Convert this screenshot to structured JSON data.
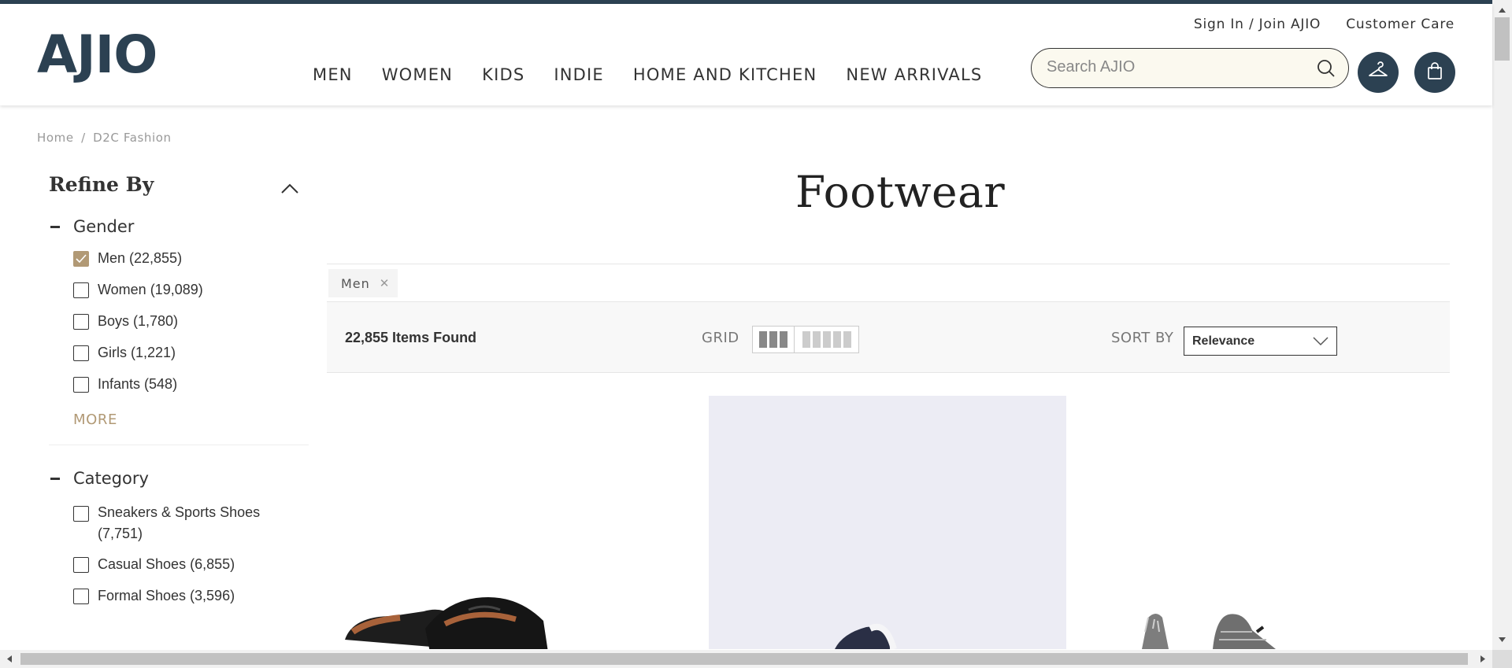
{
  "header": {
    "logo": "AJIO",
    "sign_in": "Sign In / Join AJIO",
    "customer_care": "Customer Care",
    "nav": [
      "MEN",
      "WOMEN",
      "KIDS",
      "INDIE",
      "HOME AND KITCHEN",
      "NEW ARRIVALS"
    ],
    "search_placeholder": "Search AJIO"
  },
  "breadcrumb": [
    "Home",
    "/",
    "D2C Fashion"
  ],
  "sidebar": {
    "title": "Refine By",
    "gender": {
      "label": "Gender",
      "options": [
        {
          "label": "Men (22,855)",
          "checked": true
        },
        {
          "label": "Women (19,089)",
          "checked": false
        },
        {
          "label": "Boys (1,780)",
          "checked": false
        },
        {
          "label": "Girls (1,221)",
          "checked": false
        },
        {
          "label": "Infants (548)",
          "checked": false
        }
      ],
      "more": "MORE"
    },
    "category": {
      "label": "Category",
      "options": [
        {
          "label": "Sneakers & Sports Shoes (7,751)",
          "checked": false
        },
        {
          "label": "Casual Shoes (6,855)",
          "checked": false
        },
        {
          "label": "Formal Shoes (3,596)",
          "checked": false
        }
      ]
    }
  },
  "main": {
    "title": "Footwear",
    "chip": "Men",
    "items_found": "22,855 Items Found",
    "grid_label": "GRID",
    "sort_label": "SORT BY",
    "sort_value": "Relevance"
  },
  "colors": {
    "brand": "#2c4152",
    "accent": "#b19975",
    "search_bg": "#fbf9ef"
  }
}
